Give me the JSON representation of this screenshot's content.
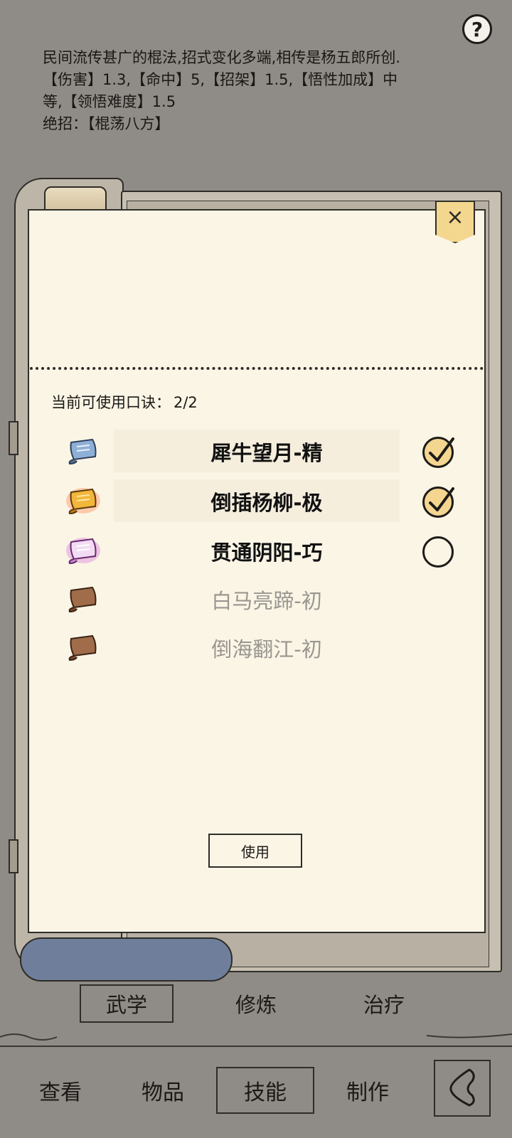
{
  "header": {
    "help_label": "?",
    "description_lines": [
      "民间流传甚广的棍法,招式变化多端,相传是杨五郎所创.",
      "【伤害】1.3,【命中】5,【招架】1.5,【悟性加成】中",
      "等,【领悟难度】1.5",
      "绝招：【棍荡八方】"
    ]
  },
  "panel": {
    "close_label": "×",
    "quota_label": "当前可使用口诀：",
    "quota_value": "2/2",
    "skills": [
      {
        "name": "犀牛望月-精",
        "icon": "blue-scroll-icon",
        "checked": true,
        "enabled": true
      },
      {
        "name": "倒插杨柳-极",
        "icon": "gold-scroll-icon",
        "checked": true,
        "enabled": true
      },
      {
        "name": "贯通阴阳-巧",
        "icon": "purple-scroll-icon",
        "checked": false,
        "enabled": true
      },
      {
        "name": "白马亮蹄-初",
        "icon": "brown-scroll-icon",
        "checked": false,
        "enabled": false
      },
      {
        "name": "倒海翻江-初",
        "icon": "brown-scroll-icon",
        "checked": false,
        "enabled": false
      }
    ],
    "use_label": "使用"
  },
  "subtabs": [
    "武学",
    "修炼",
    "治疗"
  ],
  "bottom_nav": [
    "查看",
    "物品",
    "技能",
    "制作"
  ],
  "colors": {
    "background": "#8f8c87",
    "panel": "#fbf5e6",
    "check_fill": "#f4d691",
    "blue_scroll": "#8fb0d6",
    "gold_scroll": "#f2b63a",
    "purple_scroll": "#e7b2e8",
    "brown_scroll": "#8c5a3c"
  }
}
